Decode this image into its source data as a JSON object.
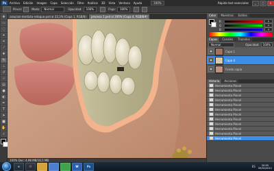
{
  "menubar": {
    "logo": "Ps",
    "items": [
      "Archivo",
      "Edición",
      "Imagen",
      "Capa",
      "Selección",
      "Filtro",
      "Análisis",
      "3D",
      "Vista",
      "Ventana",
      "Ayuda"
    ],
    "zoom": "100%",
    "workspace": "Rápido test esenciales",
    "controls": {
      "minimize": "_",
      "maximize": "□",
      "close": "×"
    }
  },
  "options": {
    "brush_label": "Pincel:",
    "mode_label": "Modo:",
    "mode_value": "Normal",
    "opacity_label": "Opacidad:",
    "opacity_value": "100%",
    "flow_label": "Flujo:",
    "flow_value": "100%"
  },
  "doc_tabs": [
    {
      "label": "solucion-dentista-retoque.psd al 33,3% (Capa 1, RGB/8)"
    },
    {
      "label": "procesa 1.psd al 200% (Capa 4, RGB/8#)"
    }
  ],
  "statusbar": {
    "text": "100%   Doc: 4,98 MB/16,5 MB"
  },
  "panels": {
    "color_tabs": [
      "Color",
      "Muestras",
      "Estilos"
    ],
    "sliders": [
      {
        "channel": "R",
        "value": "0"
      },
      {
        "channel": "G",
        "value": "0"
      },
      {
        "channel": "B",
        "value": "0"
      }
    ],
    "layers_tabs": [
      "Capas",
      "Canales",
      "Trazados"
    ],
    "blend_mode": "Normal",
    "opacity_label": "Opacidad:",
    "opacity_value": "100%",
    "layers": [
      {
        "name": "Capa 1",
        "selected": false
      },
      {
        "name": "Capa 4",
        "selected": true
      },
      {
        "name": "Fondo copia",
        "selected": false
      }
    ],
    "history_tabs": [
      "Historia",
      "Acciones"
    ],
    "history": [
      {
        "label": "Herramienta Pincel",
        "current": false
      },
      {
        "label": "Herramienta Pincel",
        "current": false
      },
      {
        "label": "Herramienta Pincel",
        "current": false
      },
      {
        "label": "Herramienta Pincel",
        "current": false
      },
      {
        "label": "Herramienta Pincel",
        "current": false
      },
      {
        "label": "Herramienta Pincel",
        "current": false
      },
      {
        "label": "Herramienta Pincel",
        "current": false
      },
      {
        "label": "Herramienta Pincel",
        "current": false
      },
      {
        "label": "Herramienta Pincel",
        "current": false
      },
      {
        "label": "Herramienta Pincel",
        "current": false
      },
      {
        "label": "Herramienta Pincel",
        "current": false
      },
      {
        "label": "Herramienta Pincel",
        "current": true
      }
    ]
  },
  "taskbar": {
    "apps": [
      "e",
      "O",
      "",
      "",
      "",
      "W",
      "Ps"
    ],
    "language": "ES",
    "time": "20:55",
    "date": "05/02/2011"
  },
  "colors": {
    "accent": "#3d8ee6",
    "workspace": "#535353"
  }
}
